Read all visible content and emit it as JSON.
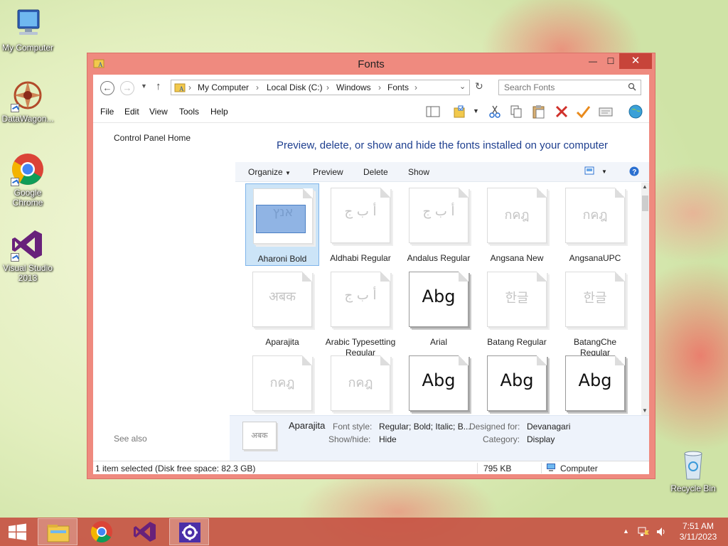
{
  "desktop": {
    "icons": [
      {
        "label": "My Computer"
      },
      {
        "label": "DataWagon..."
      },
      {
        "label": "Google Chrome"
      },
      {
        "label": "Visual Studio 2013"
      },
      {
        "label": "Recycle Bin"
      }
    ]
  },
  "window": {
    "title": "Fonts",
    "controls": {
      "minimize": "—",
      "maximize": "☐",
      "close": "✕"
    },
    "address": {
      "crumbs": [
        "My Computer",
        "Local Disk (C:)",
        "Windows",
        "Fonts"
      ],
      "search_placeholder": "Search Fonts"
    },
    "menu": [
      "File",
      "Edit",
      "View",
      "Tools",
      "Help"
    ],
    "left_nav": {
      "home": "Control Panel Home",
      "see_also": "See also"
    },
    "headline": "Preview, delete, or show and hide the fonts installed on your computer",
    "commands": [
      "Organize",
      "Preview",
      "Delete",
      "Show"
    ],
    "fonts": [
      {
        "name": "Aharoni Bold",
        "glyph": "אנץ",
        "style": "light",
        "selected": true
      },
      {
        "name": "Aldhabi Regular",
        "glyph": "أ ب ج",
        "style": "light"
      },
      {
        "name": "Andalus Regular",
        "glyph": "أ ب ج",
        "style": "light"
      },
      {
        "name": "Angsana New",
        "glyph": "กคฎ",
        "style": "light"
      },
      {
        "name": "AngsanaUPC",
        "glyph": "กคฎ",
        "style": "light"
      },
      {
        "name": "Aparajita",
        "glyph": "अबक",
        "style": "light"
      },
      {
        "name": "Arabic Typesetting Regular",
        "glyph": "أ ب ج",
        "style": "light"
      },
      {
        "name": "Arial",
        "glyph": "Abg",
        "style": "strong"
      },
      {
        "name": "Batang Regular",
        "glyph": "한글",
        "style": "light"
      },
      {
        "name": "BatangChe Regular",
        "glyph": "한글",
        "style": "light"
      },
      {
        "name": "",
        "glyph": "กคฎ",
        "style": "light"
      },
      {
        "name": "",
        "glyph": "กคฎ",
        "style": "light"
      },
      {
        "name": "",
        "glyph": "Abg",
        "style": "strong"
      },
      {
        "name": "",
        "glyph": "Abg",
        "style": "strong"
      },
      {
        "name": "",
        "glyph": "Abg",
        "style": "strong"
      }
    ],
    "details": {
      "thumb": "अबक",
      "name": "Aparajita",
      "font_style_label": "Font style:",
      "font_style": "Regular; Bold; Italic; B...",
      "designed_for_label": "Designed for:",
      "designed_for": "Devanagari",
      "show_hide_label": "Show/hide:",
      "show_hide": "Hide",
      "category_label": "Category:",
      "category": "Display"
    },
    "status": {
      "selection": "1 item selected (Disk free space: 82.3 GB)",
      "size": "795 KB",
      "location": "Computer"
    }
  },
  "taskbar": {
    "time": "7:51 AM",
    "date": "3/11/2023"
  },
  "colors": {
    "window_frame": "#ef8a7f",
    "close_button": "#c7443a",
    "headline": "#1e3f8f",
    "taskbar": "#c75444",
    "selection": "#cce4f7"
  }
}
